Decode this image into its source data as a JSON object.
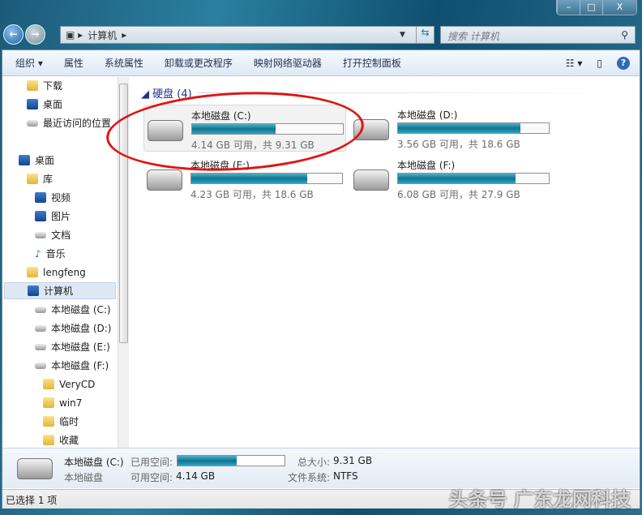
{
  "window": {
    "minimize": "–",
    "maximize": "□",
    "close": "X"
  },
  "address": {
    "crumbs": [
      "计算机"
    ]
  },
  "search": {
    "placeholder": "搜索 计算机"
  },
  "toolbar": [
    "组织 ▾",
    "属性",
    "系统属性",
    "卸载或更改程序",
    "映射网络驱动器",
    "打开控制面板"
  ],
  "sidebar": [
    {
      "label": "下载",
      "icon": "folder"
    },
    {
      "label": "桌面",
      "icon": "desktop"
    },
    {
      "label": "最近访问的位置",
      "icon": "recent"
    },
    {
      "label": "桌面",
      "icon": "desktop"
    },
    {
      "label": "库",
      "icon": "folder"
    },
    {
      "label": "视频",
      "icon": "video"
    },
    {
      "label": "图片",
      "icon": "picture"
    },
    {
      "label": "文档",
      "icon": "document"
    },
    {
      "label": "音乐",
      "icon": "music"
    },
    {
      "label": "lengfeng",
      "icon": "user"
    },
    {
      "label": "计算机",
      "icon": "computer"
    },
    {
      "label": "本地磁盘 (C:)",
      "icon": "drive"
    },
    {
      "label": "本地磁盘 (D:)",
      "icon": "drive"
    },
    {
      "label": "本地磁盘 (E:)",
      "icon": "drive"
    },
    {
      "label": "本地磁盘 (F:)",
      "icon": "drive"
    },
    {
      "label": "VeryCD",
      "icon": "folder"
    },
    {
      "label": "win7",
      "icon": "folder"
    },
    {
      "label": "临时",
      "icon": "folder"
    },
    {
      "label": "收藏",
      "icon": "folder"
    }
  ],
  "group": {
    "title": "硬盘 (4)"
  },
  "drives": [
    {
      "name": "本地磁盘 (C:)",
      "info": "4.14 GB 可用，共 9.31 GB",
      "used_fraction": 0.555
    },
    {
      "name": "本地磁盘 (D:)",
      "info": "3.56 GB 可用，共 18.6 GB",
      "used_fraction": 0.81
    },
    {
      "name": "本地磁盘 (E:)",
      "info": "4.23 GB 可用，共 18.6 GB",
      "used_fraction": 0.77
    },
    {
      "name": "本地磁盘 (F:)",
      "info": "6.08 GB 可用，共 27.9 GB",
      "used_fraction": 0.78
    }
  ],
  "details": {
    "name": "本地磁盘 (C:)",
    "type": "本地磁盘",
    "used_label": "已用空间:",
    "free_label": "可用空间:",
    "free": "4.14 GB",
    "total_label": "总大小:",
    "total": "9.31 GB",
    "fs_label": "文件系统:",
    "fs": "NTFS",
    "used_fraction": 0.555
  },
  "status": {
    "text": "已选择 1 项"
  },
  "watermark": "头条号 广东龙网科技"
}
